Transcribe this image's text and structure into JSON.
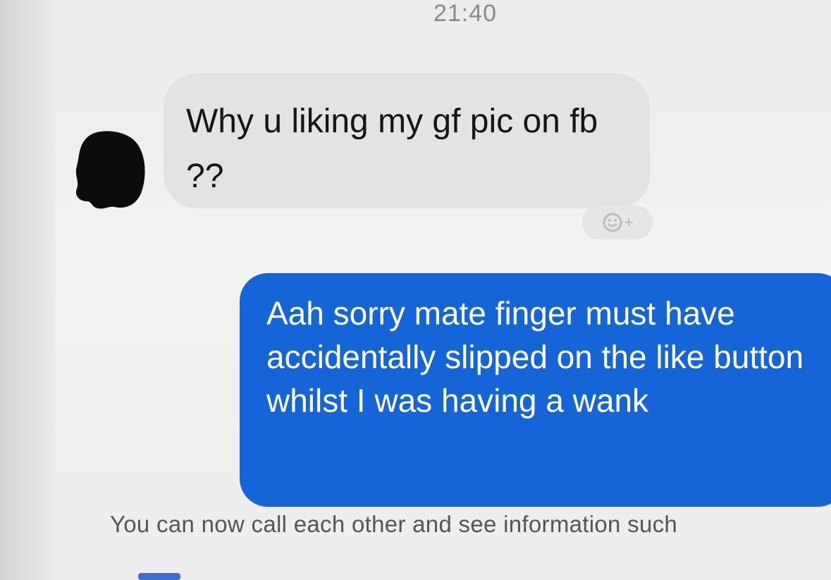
{
  "status": {
    "time": "21:40"
  },
  "conversation": {
    "messages": [
      {
        "direction": "incoming",
        "text": "Why u liking my gf pic on fb ??"
      },
      {
        "direction": "outgoing",
        "text": "Aah sorry mate finger must have accidentally slipped on the like button whilst I was having a wank"
      }
    ],
    "reaction_button_icon": "smiley-plus-icon",
    "system_notice": "You can now call each other and see information such"
  },
  "colors": {
    "outgoing_bubble": "#1565d8",
    "incoming_bubble": "#e3e3e3",
    "background": "#f0f0f0"
  }
}
